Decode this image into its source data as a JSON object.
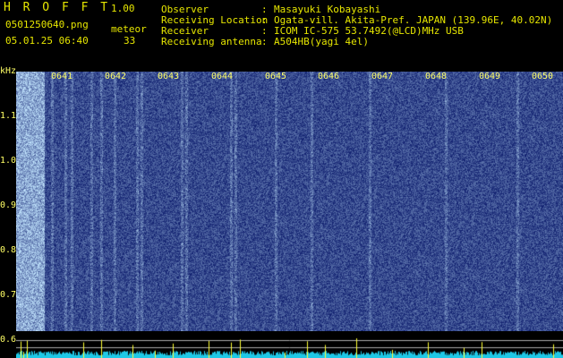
{
  "app": {
    "title": "H R O F F T",
    "version": "1.00",
    "filename": "0501250640.png",
    "meteor_label": "meteor",
    "meteor_count": "33",
    "datetime": "05.01.25 06:40"
  },
  "info": [
    {
      "key": "Observer",
      "sep": ":",
      "value": "Masayuki Kobayashi"
    },
    {
      "key": "Receiving Location",
      "sep": ":",
      "value": "Ogata-vill. Akita-Pref. JAPAN (139.96E, 40.02N)"
    },
    {
      "key": "Receiver",
      "sep": ":",
      "value": "ICOM IC-575 53.7492(@LCD)MHz USB"
    },
    {
      "key": "Receiving antenna",
      "sep": ":",
      "value": "A504HB(yagi 4el)"
    }
  ],
  "spectrogram": {
    "y_unit": "kHz",
    "y_ticks": [
      "1.1",
      "1.0",
      "0.9",
      "0.8",
      "0.7",
      "0.6"
    ],
    "x_ticks": [
      "0641",
      "0642",
      "0643",
      "0644",
      "0645",
      "0646",
      "0647",
      "0648",
      "0649",
      "0650"
    ],
    "colors": {
      "background": "#0a1a70",
      "noise": "#2a5ad0",
      "hot": "#ffffff",
      "label": "#ffff66"
    }
  }
}
